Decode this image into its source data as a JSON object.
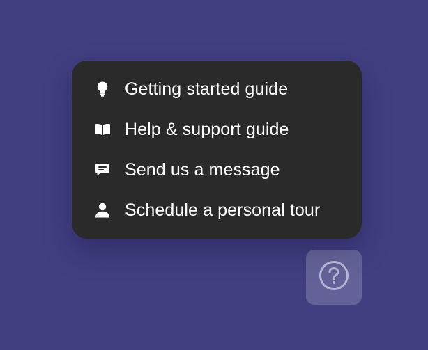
{
  "menu": {
    "items": [
      {
        "label": "Getting started guide",
        "icon": "lightbulb-icon"
      },
      {
        "label": "Help & support guide",
        "icon": "book-icon"
      },
      {
        "label": "Send us a message",
        "icon": "chat-bubble-icon"
      },
      {
        "label": "Schedule a personal tour",
        "icon": "person-icon"
      }
    ]
  },
  "help_button": {
    "icon": "question-circle-icon"
  },
  "colors": {
    "background": "#413f80",
    "menu_background": "#2a2a2a",
    "text": "#ffffff",
    "help_button_icon": "#b4b3d4"
  }
}
